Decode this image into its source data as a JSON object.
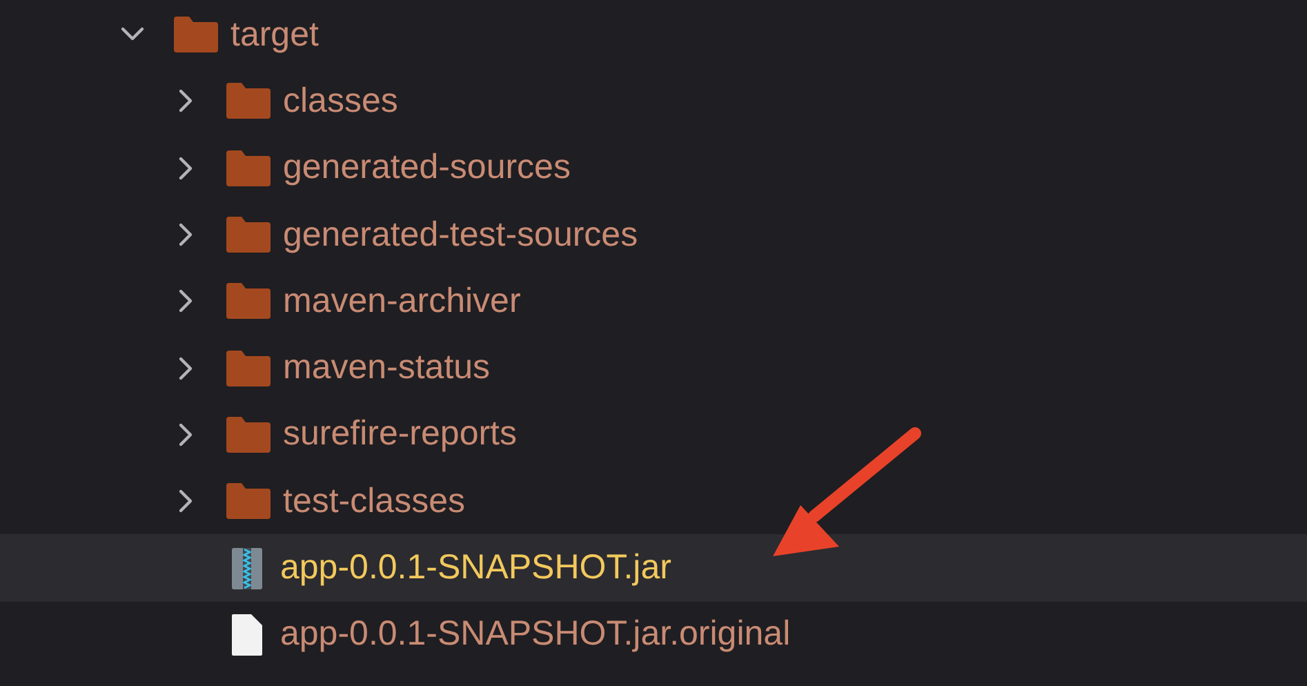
{
  "tree": [
    {
      "name": "target",
      "kind": "folder",
      "expanded": true,
      "selected": false,
      "children": [
        {
          "name": "classes",
          "kind": "folder",
          "expanded": false,
          "selected": false
        },
        {
          "name": "generated-sources",
          "kind": "folder",
          "expanded": false,
          "selected": false
        },
        {
          "name": "generated-test-sources",
          "kind": "folder",
          "expanded": false,
          "selected": false
        },
        {
          "name": "maven-archiver",
          "kind": "folder",
          "expanded": false,
          "selected": false
        },
        {
          "name": "maven-status",
          "kind": "folder",
          "expanded": false,
          "selected": false
        },
        {
          "name": "surefire-reports",
          "kind": "folder",
          "expanded": false,
          "selected": false
        },
        {
          "name": "test-classes",
          "kind": "folder",
          "expanded": false,
          "selected": false
        },
        {
          "name": "app-0.0.1-SNAPSHOT.jar",
          "kind": "jar",
          "selected": true
        },
        {
          "name": "app-0.0.1-SNAPSHOT.jar.original",
          "kind": "file",
          "selected": false
        }
      ]
    }
  ]
}
